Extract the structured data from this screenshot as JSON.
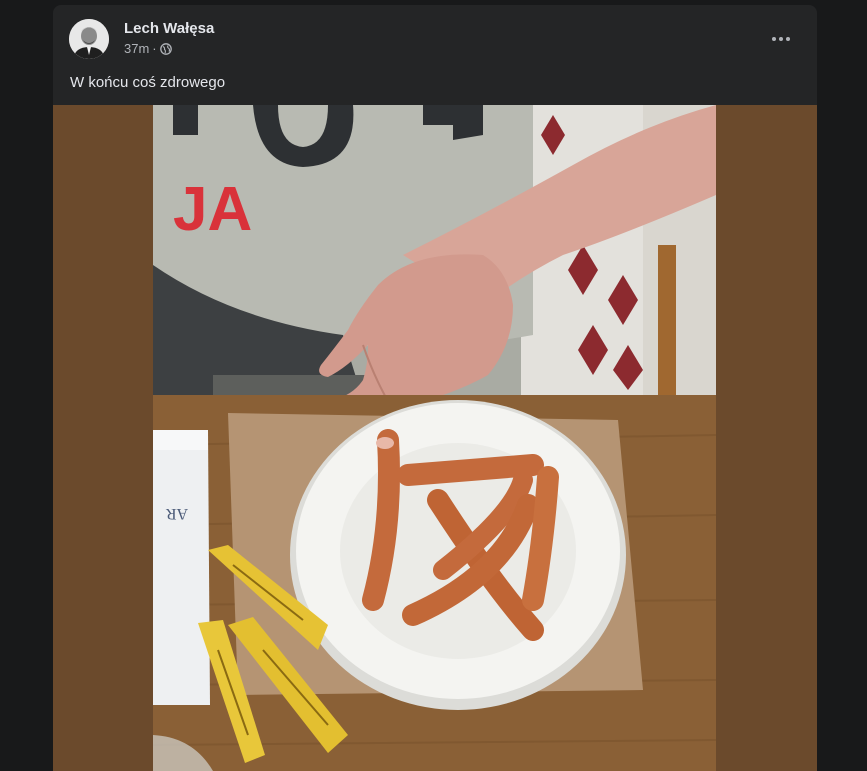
{
  "post": {
    "author": "Lech Wałęsa",
    "time": "37m",
    "separator": "·",
    "privacy_icon": "globe-icon",
    "more_icon": "more-options-icon",
    "text": "W końcu coś zdrowego"
  },
  "photo": {
    "shirt_letters": "JA",
    "napkin_text": "AR"
  },
  "colors": {
    "page_bg": "#18191a",
    "card_bg": "#242526",
    "primary_text": "#e4e6eb",
    "secondary_text": "#b0b3b8",
    "media_backdrop": "#6b4a2c"
  }
}
